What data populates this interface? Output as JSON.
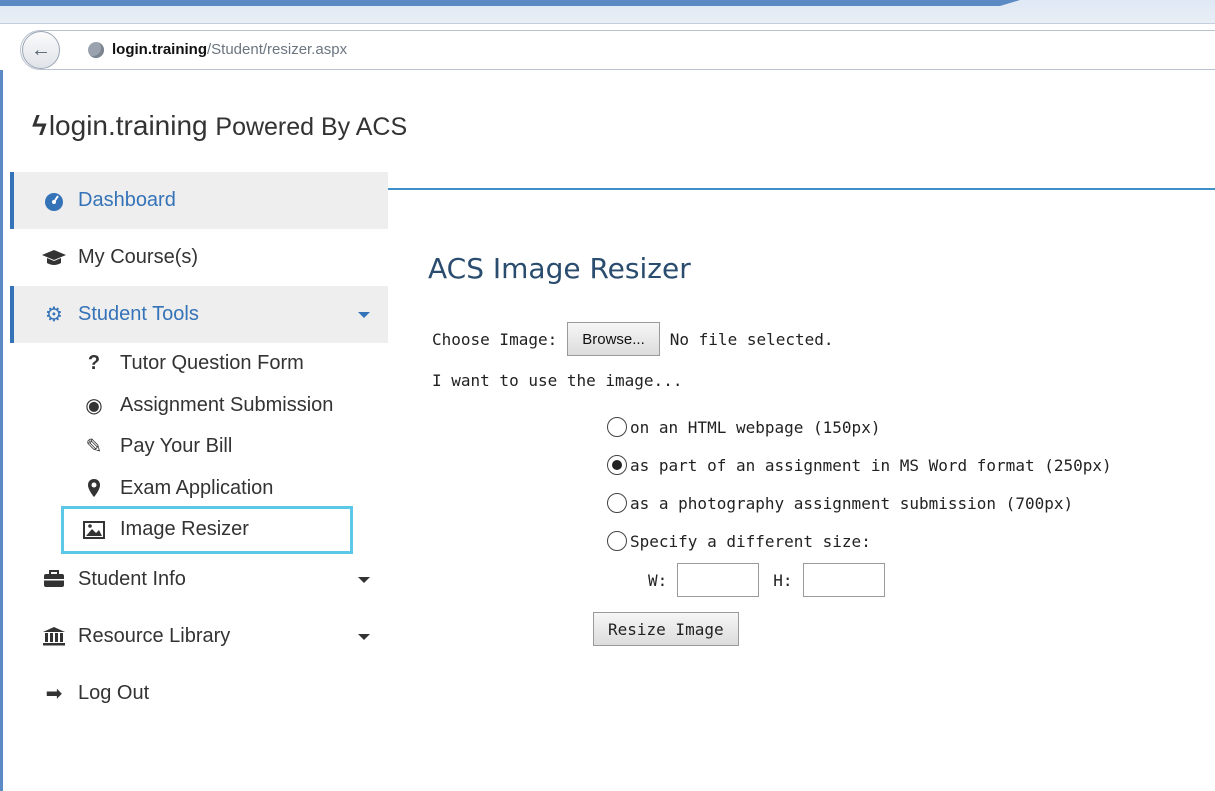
{
  "browser": {
    "url_host": "login.training",
    "url_path": "/Student/resizer.aspx"
  },
  "brand": {
    "name": "login.training",
    "tagline": "Powered By ACS"
  },
  "sidebar": {
    "items": [
      {
        "label": "Dashboard",
        "icon": "dashboard-icon"
      },
      {
        "label": "My Course(s)",
        "icon": "graduation-cap-icon"
      },
      {
        "label": "Student Tools",
        "icon": "gears-icon"
      },
      {
        "label": "Student Info",
        "icon": "briefcase-icon"
      },
      {
        "label": "Resource Library",
        "icon": "institution-icon"
      },
      {
        "label": "Log Out",
        "icon": "sign-out-icon"
      }
    ],
    "sub_items": [
      {
        "label": "Tutor Question Form",
        "icon": "question-icon"
      },
      {
        "label": "Assignment Submission",
        "icon": "bullseye-icon"
      },
      {
        "label": "Pay Your Bill",
        "icon": "edit-icon"
      },
      {
        "label": "Exam Application",
        "icon": "map-marker-icon"
      },
      {
        "label": "Image Resizer",
        "icon": "image-icon"
      }
    ]
  },
  "main": {
    "title": "ACS Image Resizer",
    "choose_label": "Choose Image:",
    "browse_label": "Browse...",
    "file_status": "No file selected.",
    "intro": "I want to use the image...",
    "options": [
      {
        "label": "on an HTML webpage (150px)",
        "checked": false
      },
      {
        "label": "as part of an assignment in MS Word format (250px)",
        "checked": true
      },
      {
        "label": "as a photography assignment submission (700px)",
        "checked": false
      },
      {
        "label": "Specify a different size:",
        "checked": false
      }
    ],
    "width_label": "W:",
    "height_label": "H:",
    "width_value": "",
    "height_value": "",
    "resize_label": "Resize Image"
  },
  "colors": {
    "accent": "#3473b8",
    "highlight_outline": "#5bc8e8",
    "title": "#2a4c6e"
  }
}
